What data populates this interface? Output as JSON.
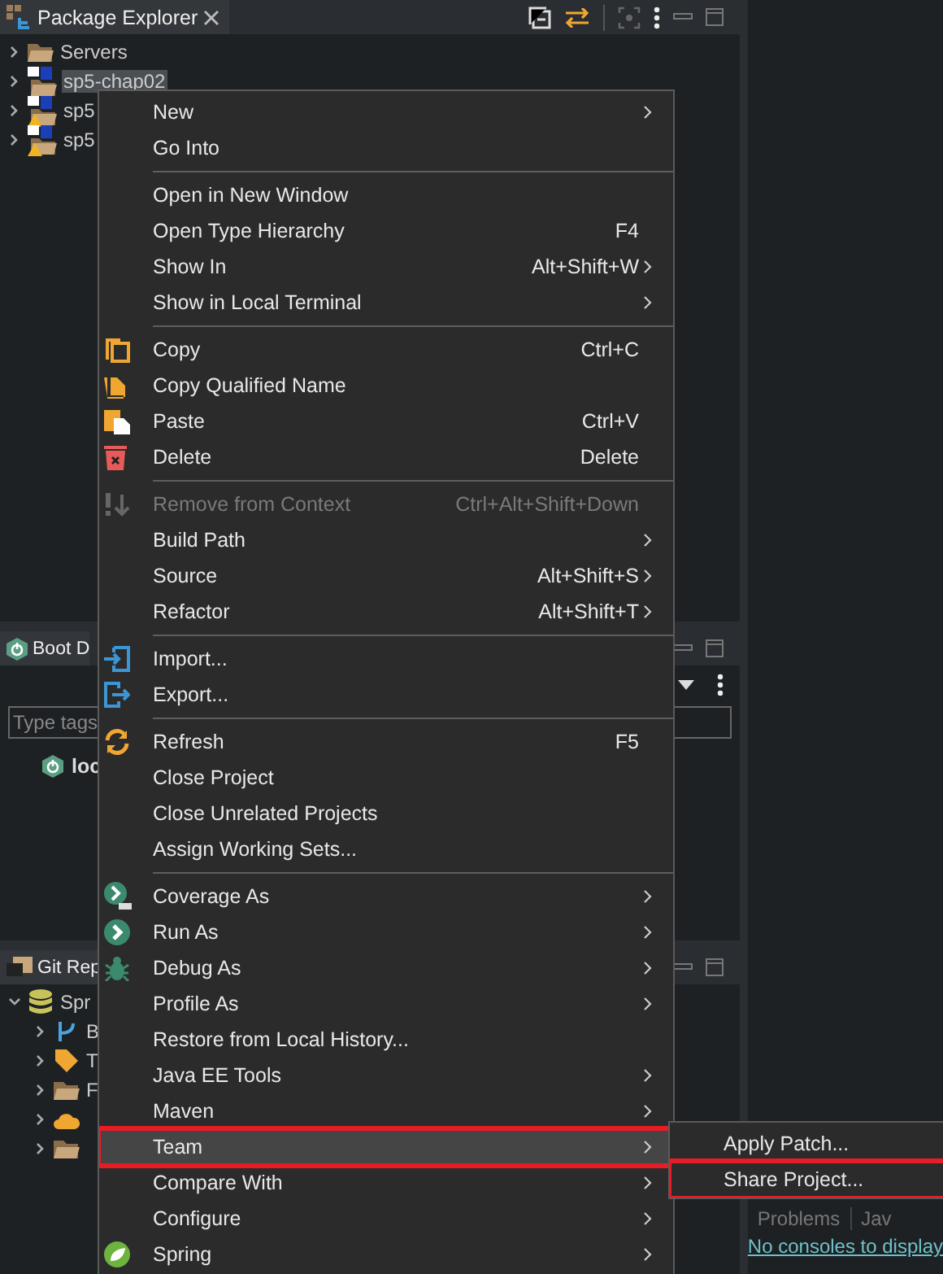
{
  "package_explorer": {
    "title": "Package Explorer",
    "tree": [
      {
        "label": "Servers",
        "kind": "folder",
        "expanded": false,
        "selected": false,
        "warning": false
      },
      {
        "label": "sp5-chap02",
        "kind": "project",
        "expanded": false,
        "selected": true,
        "warning": false
      },
      {
        "label": "sp5",
        "kind": "project",
        "expanded": false,
        "selected": false,
        "warning": true
      },
      {
        "label": "sp5",
        "kind": "project",
        "expanded": false,
        "selected": false,
        "warning": true
      }
    ]
  },
  "boot_dashboard": {
    "title": "Boot D",
    "tag_filter": {
      "placeholder": "Type tags"
    },
    "items": [
      {
        "label": "loc"
      }
    ]
  },
  "git_repositories": {
    "title": "Git Rep",
    "tree": [
      {
        "label": "Spr",
        "kind": "database",
        "expanded": true,
        "children": [
          {
            "label": "B",
            "kind": "branch",
            "expanded": false
          },
          {
            "label": "T",
            "kind": "tag",
            "expanded": false
          },
          {
            "label": "F",
            "kind": "folder",
            "expanded": false
          },
          {
            "kind": "cloud",
            "expanded": false
          },
          {
            "kind": "folder",
            "expanded": false
          }
        ]
      }
    ]
  },
  "console": {
    "tabs": [
      {
        "label": "Problems"
      },
      {
        "label": "Jav"
      }
    ],
    "message": "No consoles to display"
  },
  "context_menu": {
    "groups": [
      [
        {
          "label": "New",
          "submenu": true,
          "disabled": false,
          "selected": false,
          "marked": false
        },
        {
          "label": "Go Into",
          "submenu": false,
          "disabled": false,
          "selected": false,
          "marked": false
        }
      ],
      [
        {
          "label": "Open in New Window",
          "submenu": false,
          "disabled": false,
          "selected": false,
          "marked": false
        },
        {
          "label": "Open Type Hierarchy",
          "shortcut": "F4",
          "submenu": false,
          "disabled": false,
          "selected": false,
          "marked": false
        },
        {
          "label": "Show In",
          "shortcut": "Alt+Shift+W",
          "submenu": true,
          "disabled": false,
          "selected": false,
          "marked": false
        },
        {
          "label": "Show in Local Terminal",
          "submenu": true,
          "disabled": false,
          "selected": false,
          "marked": false
        }
      ],
      [
        {
          "label": "Copy",
          "kind": "copy",
          "shortcut": "Ctrl+C",
          "submenu": false,
          "disabled": false,
          "selected": false,
          "marked": false
        },
        {
          "label": "Copy Qualified Name",
          "kind": "document",
          "submenu": false,
          "disabled": false,
          "selected": false,
          "marked": false
        },
        {
          "label": "Paste",
          "kind": "paste",
          "shortcut": "Ctrl+V",
          "submenu": false,
          "disabled": false,
          "selected": false,
          "marked": false
        },
        {
          "label": "Delete",
          "kind": "delete",
          "shortcut": "Delete",
          "submenu": false,
          "disabled": false,
          "selected": false,
          "marked": false
        }
      ],
      [
        {
          "label": "Remove from Context",
          "kind": "remove",
          "shortcut": "Ctrl+Alt+Shift+Down",
          "submenu": false,
          "disabled": true,
          "selected": false,
          "marked": false
        },
        {
          "label": "Build Path",
          "submenu": true,
          "disabled": false,
          "selected": false,
          "marked": false
        },
        {
          "label": "Source",
          "shortcut": "Alt+Shift+S",
          "submenu": true,
          "disabled": false,
          "selected": false,
          "marked": false
        },
        {
          "label": "Refactor",
          "shortcut": "Alt+Shift+T",
          "submenu": true,
          "disabled": false,
          "selected": false,
          "marked": false
        }
      ],
      [
        {
          "label": "Import...",
          "kind": "import",
          "submenu": false,
          "disabled": false,
          "selected": false,
          "marked": false
        },
        {
          "label": "Export...",
          "kind": "export",
          "submenu": false,
          "disabled": false,
          "selected": false,
          "marked": false
        }
      ],
      [
        {
          "label": "Refresh",
          "kind": "refresh",
          "shortcut": "F5",
          "submenu": false,
          "disabled": false,
          "selected": false,
          "marked": false
        },
        {
          "label": "Close Project",
          "submenu": false,
          "disabled": false,
          "selected": false,
          "marked": false
        },
        {
          "label": "Close Unrelated Projects",
          "submenu": false,
          "disabled": false,
          "selected": false,
          "marked": false
        },
        {
          "label": "Assign Working Sets...",
          "submenu": false,
          "disabled": false,
          "selected": false,
          "marked": false
        }
      ],
      [
        {
          "label": "Coverage As",
          "kind": "coverage",
          "submenu": true,
          "disabled": false,
          "selected": false,
          "marked": false
        },
        {
          "label": "Run As",
          "kind": "run",
          "submenu": true,
          "disabled": false,
          "selected": false,
          "marked": false
        },
        {
          "label": "Debug As",
          "kind": "debug",
          "submenu": true,
          "disabled": false,
          "selected": false,
          "marked": false
        },
        {
          "label": "Profile As",
          "submenu": true,
          "disabled": false,
          "selected": false,
          "marked": false
        },
        {
          "label": "Restore from Local History...",
          "submenu": false,
          "disabled": false,
          "selected": false,
          "marked": false
        },
        {
          "label": "Java EE Tools",
          "submenu": true,
          "disabled": false,
          "selected": false,
          "marked": false
        },
        {
          "label": "Maven",
          "submenu": true,
          "disabled": false,
          "selected": false,
          "marked": false
        },
        {
          "label": "Team",
          "submenu": true,
          "disabled": false,
          "selected": true,
          "marked": true
        },
        {
          "label": "Compare With",
          "submenu": true,
          "disabled": false,
          "selected": false,
          "marked": false
        },
        {
          "label": "Configure",
          "submenu": true,
          "disabled": false,
          "selected": false,
          "marked": false
        },
        {
          "label": "Spring",
          "kind": "spring",
          "submenu": true,
          "disabled": false,
          "selected": false,
          "marked": false
        }
      ]
    ]
  },
  "submenu": {
    "items": [
      {
        "label": "Apply Patch...",
        "selected": false,
        "marked": false
      },
      {
        "label": "Share Project...",
        "selected": false,
        "marked": true
      }
    ]
  }
}
